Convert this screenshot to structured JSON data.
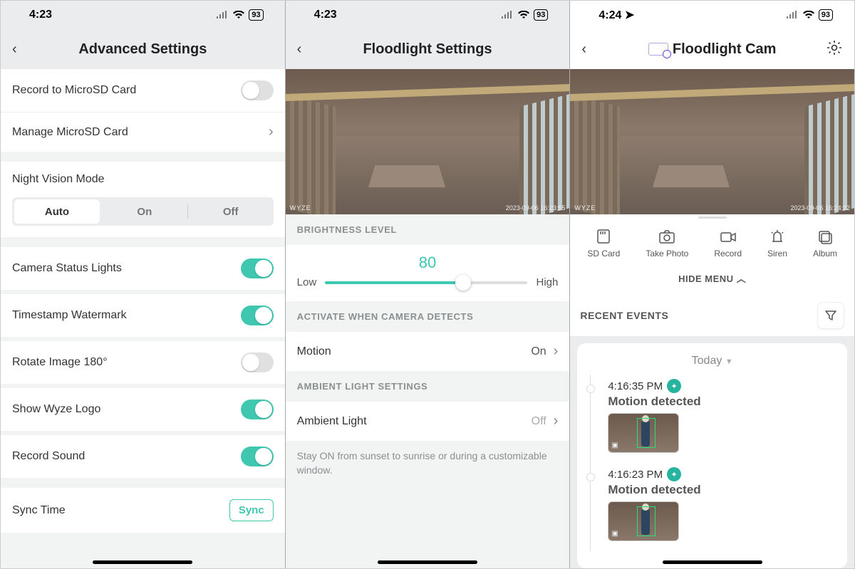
{
  "phone1": {
    "time": "4:23",
    "battery": "93",
    "title": "Advanced Settings",
    "record_sd": {
      "label": "Record to MicroSD Card",
      "on": false
    },
    "manage_sd": "Manage MicroSD Card",
    "night_vision": {
      "label": "Night Vision Mode",
      "options": [
        "Auto",
        "On",
        "Off"
      ],
      "selected": "Auto"
    },
    "status_lights": {
      "label": "Camera Status Lights",
      "on": true
    },
    "timestamp": {
      "label": "Timestamp Watermark",
      "on": true
    },
    "rotate": {
      "label": "Rotate Image 180°",
      "on": false
    },
    "logo": {
      "label": "Show Wyze Logo",
      "on": true
    },
    "sound": {
      "label": "Record Sound",
      "on": true
    },
    "sync_time": {
      "label": "Sync Time",
      "button": "Sync"
    }
  },
  "phone2": {
    "time": "4:23",
    "battery": "93",
    "title": "Floodlight Settings",
    "cam": {
      "watermark": "WYZE",
      "timestamp": "2023-09-06 16:23:55"
    },
    "brightness": {
      "header": "BRIGHTNESS LEVEL",
      "value": "80",
      "low": "Low",
      "high": "High",
      "percent": 68
    },
    "activate": {
      "header": "ACTIVATE WHEN CAMERA DETECTS",
      "motion_label": "Motion",
      "motion_value": "On"
    },
    "ambient": {
      "header": "AMBIENT LIGHT SETTINGS",
      "label": "Ambient Light",
      "value": "Off",
      "desc": "Stay ON from sunset to sunrise or during a customizable window."
    }
  },
  "phone3": {
    "time": "4:24",
    "battery": "93",
    "title": "Floodlight Cam",
    "cam": {
      "watermark": "WYZE",
      "timestamp": "2023-09-06 16:24:22"
    },
    "quick": {
      "sd": "SD Card",
      "photo": "Take Photo",
      "record": "Record",
      "siren": "Siren",
      "album": "Album"
    },
    "hide_menu": "HIDE MENU",
    "events_header": "RECENT EVENTS",
    "day": "Today",
    "events": [
      {
        "time": "4:16:35 PM",
        "title": "Motion detected"
      },
      {
        "time": "4:16:23 PM",
        "title": "Motion detected"
      }
    ]
  }
}
